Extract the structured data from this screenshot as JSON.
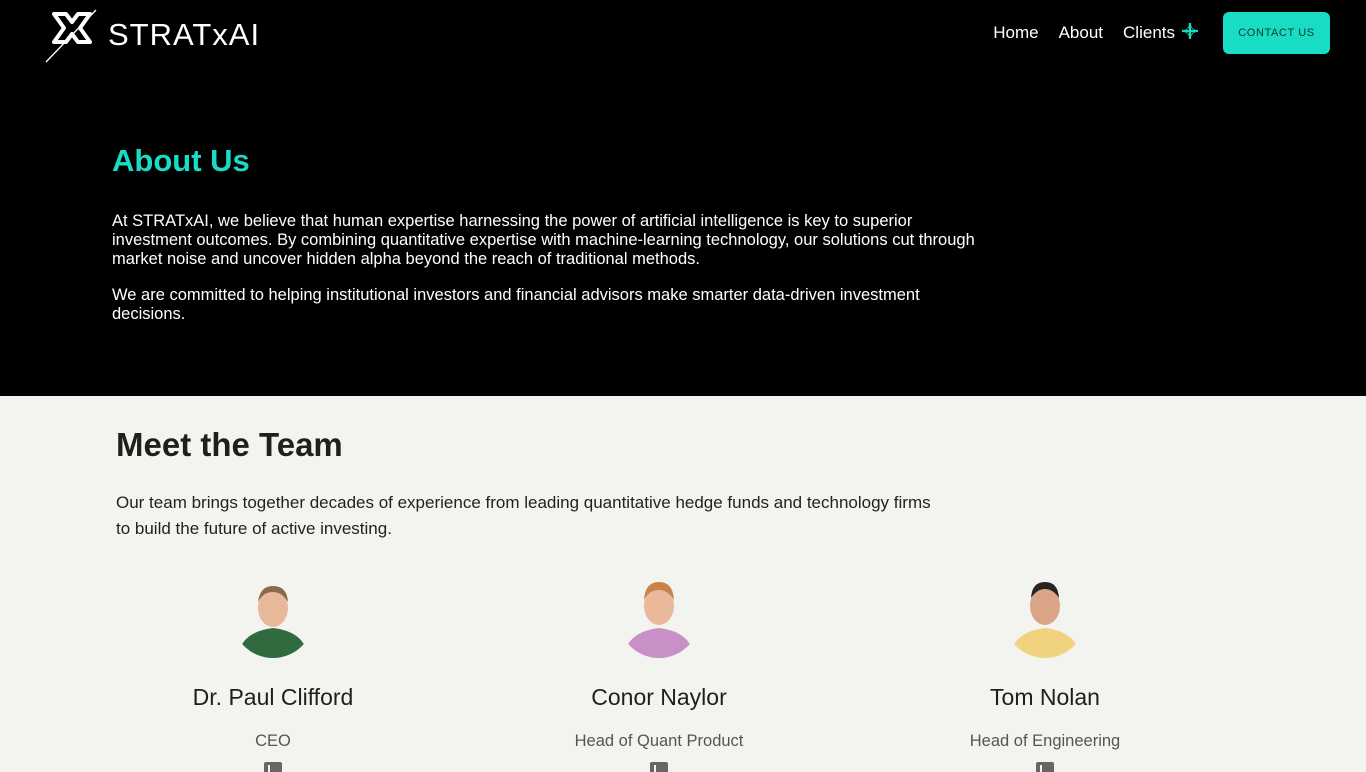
{
  "brand": {
    "name": "STRATxAI"
  },
  "nav": {
    "home": "Home",
    "about": "About",
    "clients": "Clients",
    "contact": "CONTACT US"
  },
  "about": {
    "title": "About Us",
    "p1": "At STRATxAI, we believe that human expertise harnessing the power of artificial intelligence is key to superior investment outcomes. By combining quantitative expertise with machine-learning technology, our solutions cut through market noise and uncover hidden alpha beyond the reach of traditional methods.",
    "p2": "We are committed to helping institutional investors and financial advisors make smarter data-driven investment decisions."
  },
  "team": {
    "title": "Meet the Team",
    "intro": "Our team brings together decades of experience from leading quantitative hedge funds and technology firms to build the future of active investing.",
    "members": [
      {
        "name": "Dr. Paul Clifford",
        "role": "CEO",
        "shirt": "#2f6b3f",
        "hair": "#8a6a4a"
      },
      {
        "name": "Conor Naylor",
        "role": "Head of Quant Product",
        "shirt": "#c990c8",
        "hair": "#c8834b"
      },
      {
        "name": "Tom Nolan",
        "role": "Head of Engineering",
        "shirt": "#f1d27f",
        "hair": "#2a2420"
      }
    ]
  },
  "colors": {
    "accent": "#19dcc4",
    "hero_bg": "#000000",
    "section_bg": "#f3f3ef"
  }
}
